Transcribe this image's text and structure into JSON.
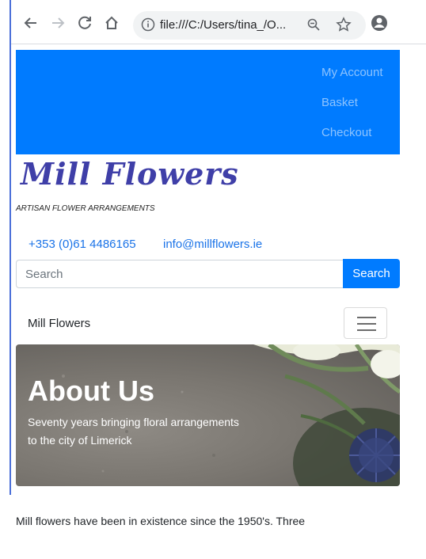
{
  "browser": {
    "url": "file:///C:/Users/tina_/O...",
    "icons": [
      "back-arrow-icon",
      "forward-arrow-icon",
      "reload-icon",
      "home-icon",
      "info-icon",
      "zoom-icon",
      "star-icon",
      "account-icon"
    ]
  },
  "topnav": {
    "items": [
      {
        "label": "My Account"
      },
      {
        "label": "Basket"
      },
      {
        "label": "Checkout"
      }
    ],
    "background": "#007bff"
  },
  "brand": {
    "logo_text": "Mill Flowers",
    "tagline": "ARTISAN FLOWER ARRANGEMENTS"
  },
  "contact": {
    "phone": "+353 (0)61 4486165",
    "email": "info@millflowers.ie"
  },
  "search": {
    "placeholder": "Search",
    "button_label": "Search"
  },
  "navbar": {
    "brand_label": "Mill Flowers",
    "toggler_icon": "hamburger-icon"
  },
  "hero": {
    "title": "About Us",
    "subtitle_line1": "Seventy years bringing floral arrangements",
    "subtitle_line2": "to the city of Limerick"
  },
  "content": {
    "intro": "Mill flowers have been in existence since the 1950's. Three"
  },
  "colors": {
    "primary": "#007bff",
    "logo": "#3f3fa8",
    "link": "#1a73e8"
  }
}
